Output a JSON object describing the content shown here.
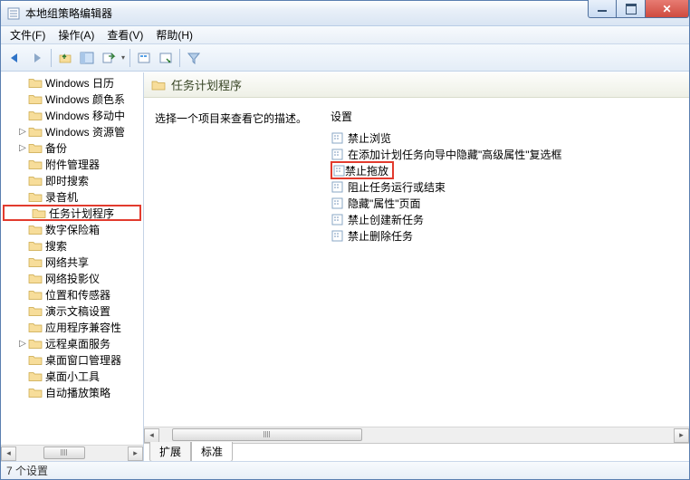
{
  "window": {
    "title": "本地组策略编辑器"
  },
  "menu": {
    "file": "文件(F)",
    "action": "操作(A)",
    "view": "查看(V)",
    "help": "帮助(H)"
  },
  "tree": {
    "items": [
      {
        "label": "Windows 日历",
        "expand": ""
      },
      {
        "label": "Windows 颜色系",
        "expand": ""
      },
      {
        "label": "Windows 移动中",
        "expand": ""
      },
      {
        "label": "Windows 资源管",
        "expand": "▷"
      },
      {
        "label": "备份",
        "expand": "▷"
      },
      {
        "label": "附件管理器",
        "expand": ""
      },
      {
        "label": "即时搜索",
        "expand": ""
      },
      {
        "label": "录音机",
        "expand": ""
      },
      {
        "label": "任务计划程序",
        "expand": "",
        "selected": true
      },
      {
        "label": "数字保险箱",
        "expand": ""
      },
      {
        "label": "搜索",
        "expand": ""
      },
      {
        "label": "网络共享",
        "expand": ""
      },
      {
        "label": "网络投影仪",
        "expand": ""
      },
      {
        "label": "位置和传感器",
        "expand": ""
      },
      {
        "label": "演示文稿设置",
        "expand": ""
      },
      {
        "label": "应用程序兼容性",
        "expand": ""
      },
      {
        "label": "远程桌面服务",
        "expand": "▷"
      },
      {
        "label": "桌面窗口管理器",
        "expand": ""
      },
      {
        "label": "桌面小工具",
        "expand": ""
      },
      {
        "label": "自动播放策略",
        "expand": ""
      }
    ]
  },
  "detail": {
    "header_title": "任务计划程序",
    "desc_prompt": "选择一个项目来查看它的描述。",
    "settings_header": "设置",
    "settings": [
      {
        "label": "禁止浏览"
      },
      {
        "label": "在添加计划任务向导中隐藏\"高级属性\"复选框"
      },
      {
        "label": "禁止拖放",
        "highlighted": true
      },
      {
        "label": "阻止任务运行或结束"
      },
      {
        "label": "隐藏\"属性\"页面"
      },
      {
        "label": "禁止创建新任务"
      },
      {
        "label": "禁止删除任务"
      }
    ]
  },
  "tabs": {
    "extended": "扩展",
    "standard": "标准"
  },
  "status": {
    "text": "7 个设置"
  }
}
